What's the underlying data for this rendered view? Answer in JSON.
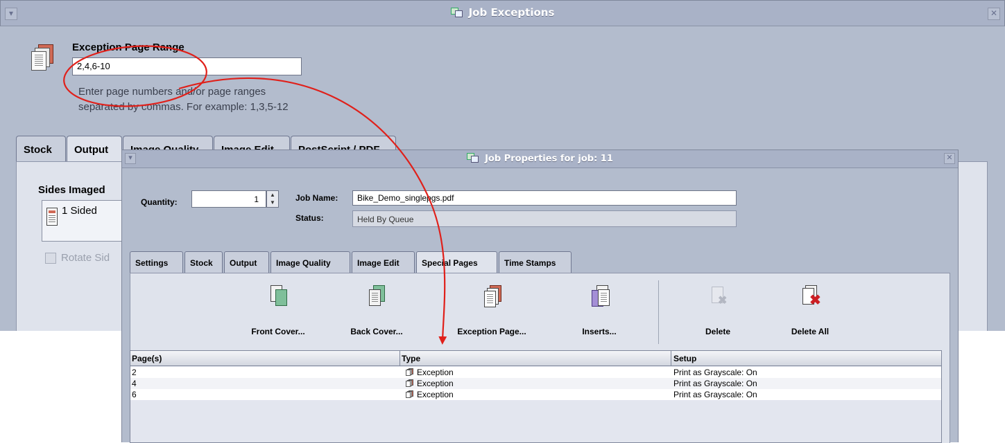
{
  "exceptions_window": {
    "title": "Job Exceptions",
    "range_label": "Exception Page Range",
    "range_value": "2,4,6-10",
    "hint_line1": "Enter page numbers and/or page ranges",
    "hint_line2": "separated by commas.  For example: 1,3,5-12",
    "tabs": [
      "Stock",
      "Output",
      "Image Quality",
      "Image Edit",
      "PostScript / PDF"
    ],
    "sides_label": "Sides Imaged",
    "sides_value": "1 Sided",
    "rotate_label": "Rotate Sid"
  },
  "properties_window": {
    "title": "Job Properties for job: 11",
    "quantity_label": "Quantity:",
    "quantity_value": "1",
    "jobname_label": "Job Name:",
    "jobname_value": "Bike_Demo_singlepgs.pdf",
    "status_label": "Status:",
    "status_value": "Held By Queue",
    "tabs": [
      "Settings",
      "Stock",
      "Output",
      "Image Quality",
      "Image Edit",
      "Special Pages",
      "Time Stamps"
    ],
    "active_tab": "Special Pages",
    "toolbar": {
      "front_cover": "Front Cover...",
      "back_cover": "Back Cover...",
      "exception_page": "Exception Page...",
      "inserts": "Inserts...",
      "delete": "Delete",
      "delete_all": "Delete All"
    },
    "table": {
      "columns": [
        "Page(s)",
        "Type",
        "Setup"
      ],
      "rows": [
        {
          "pages": "2",
          "type": "Exception",
          "setup": "Print as Grayscale: On"
        },
        {
          "pages": "4",
          "type": "Exception",
          "setup": "Print as Grayscale: On"
        },
        {
          "pages": "6",
          "type": "Exception",
          "setup": "Print as Grayscale: On"
        }
      ]
    }
  },
  "colors": {
    "window_bg": "#b3bccd",
    "panel_bg": "#dfe3ec",
    "annotation": "#e0201a"
  }
}
